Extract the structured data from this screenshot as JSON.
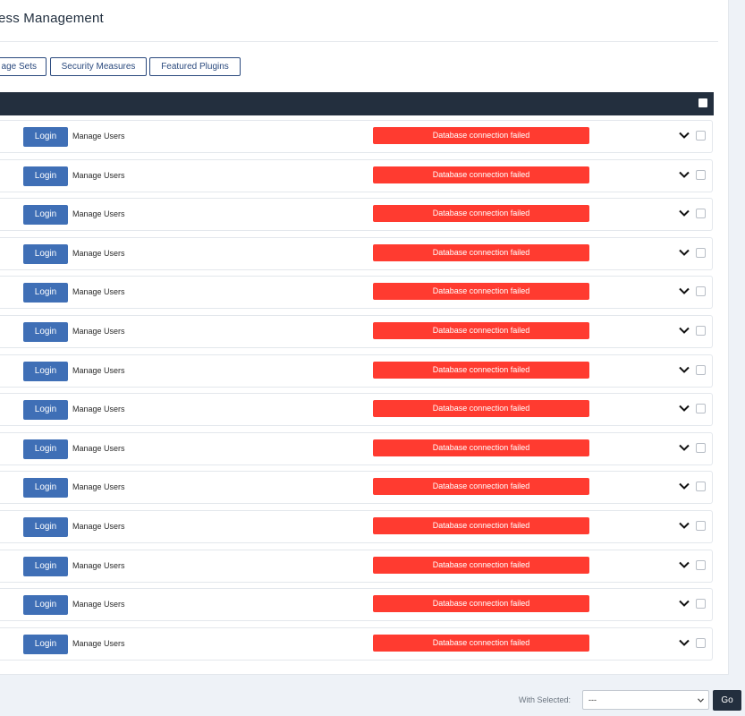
{
  "header": {
    "title": "ess Management"
  },
  "tabs": [
    {
      "label": "age Sets"
    },
    {
      "label": "Security Measures"
    },
    {
      "label": "Featured Plugins"
    }
  ],
  "table": {
    "rows": [
      {
        "login_label": "Login",
        "manage_label": "Manage Users",
        "status": "Database connection failed"
      },
      {
        "login_label": "Login",
        "manage_label": "Manage Users",
        "status": "Database connection failed"
      },
      {
        "login_label": "Login",
        "manage_label": "Manage Users",
        "status": "Database connection failed"
      },
      {
        "login_label": "Login",
        "manage_label": "Manage Users",
        "status": "Database connection failed"
      },
      {
        "login_label": "Login",
        "manage_label": "Manage Users",
        "status": "Database connection failed"
      },
      {
        "login_label": "Login",
        "manage_label": "Manage Users",
        "status": "Database connection failed"
      },
      {
        "login_label": "Login",
        "manage_label": "Manage Users",
        "status": "Database connection failed"
      },
      {
        "login_label": "Login",
        "manage_label": "Manage Users",
        "status": "Database connection failed"
      },
      {
        "login_label": "Login",
        "manage_label": "Manage Users",
        "status": "Database connection failed"
      },
      {
        "login_label": "Login",
        "manage_label": "Manage Users",
        "status": "Database connection failed"
      },
      {
        "login_label": "Login",
        "manage_label": "Manage Users",
        "status": "Database connection failed"
      },
      {
        "login_label": "Login",
        "manage_label": "Manage Users",
        "status": "Database connection failed"
      },
      {
        "login_label": "Login",
        "manage_label": "Manage Users",
        "status": "Database connection failed"
      },
      {
        "login_label": "Login",
        "manage_label": "Manage Users",
        "status": "Database connection failed"
      }
    ]
  },
  "footer": {
    "with_selected_label": "With Selected:",
    "select_value": "---",
    "go_label": "Go"
  },
  "colors": {
    "header_bg": "#232f3e",
    "button_blue": "#3f6fb6",
    "status_error": "#ff3b30",
    "tab_border": "#2b4a7e"
  },
  "icons": {
    "row_toggle": "chevron-down-icon",
    "select_caret": "chevron-down-icon"
  }
}
